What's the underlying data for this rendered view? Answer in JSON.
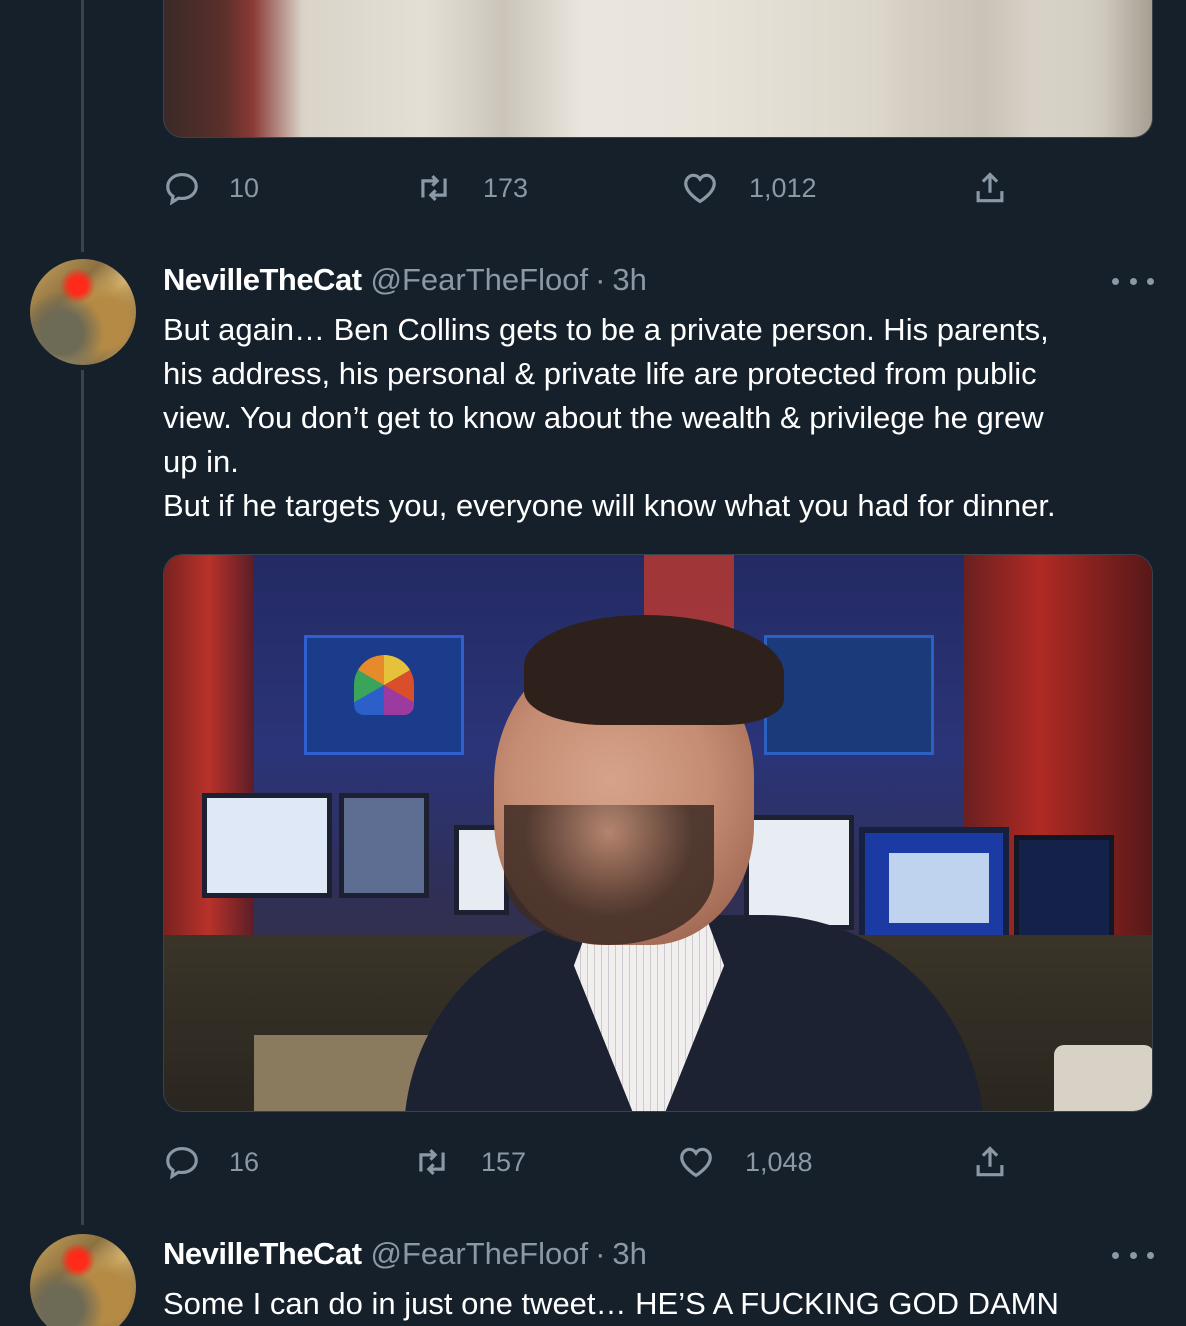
{
  "tweets": [
    {
      "stats": {
        "replies": "10",
        "retweets": "173",
        "likes": "1,012"
      }
    },
    {
      "display_name": "NevilleTheCat",
      "handle": "@FearTheFloof",
      "separator": "·",
      "time": "3h",
      "text": "But again… Ben Collins gets to be a private person. His parents,\nhis address, his personal & private life are protected from public\nview. You don’t get to know about the wealth & privilege he grew\nup in.\nBut if he targets you, everyone will know what you had for dinner.",
      "stats": {
        "replies": "16",
        "retweets": "157",
        "likes": "1,048"
      }
    },
    {
      "display_name": "NevilleTheCat",
      "handle": "@FearTheFloof",
      "separator": "·",
      "time": "3h",
      "text": "Some I can do in just one tweet… HE’S A FUCKING GOD DAMN"
    }
  ],
  "icons": {
    "reply": "reply-icon",
    "retweet": "retweet-icon",
    "like": "heart-icon",
    "share": "share-icon",
    "more": "more-icon"
  },
  "colors": {
    "background": "#15202b",
    "secondary_text": "#8b98a5",
    "border": "#38444d"
  }
}
